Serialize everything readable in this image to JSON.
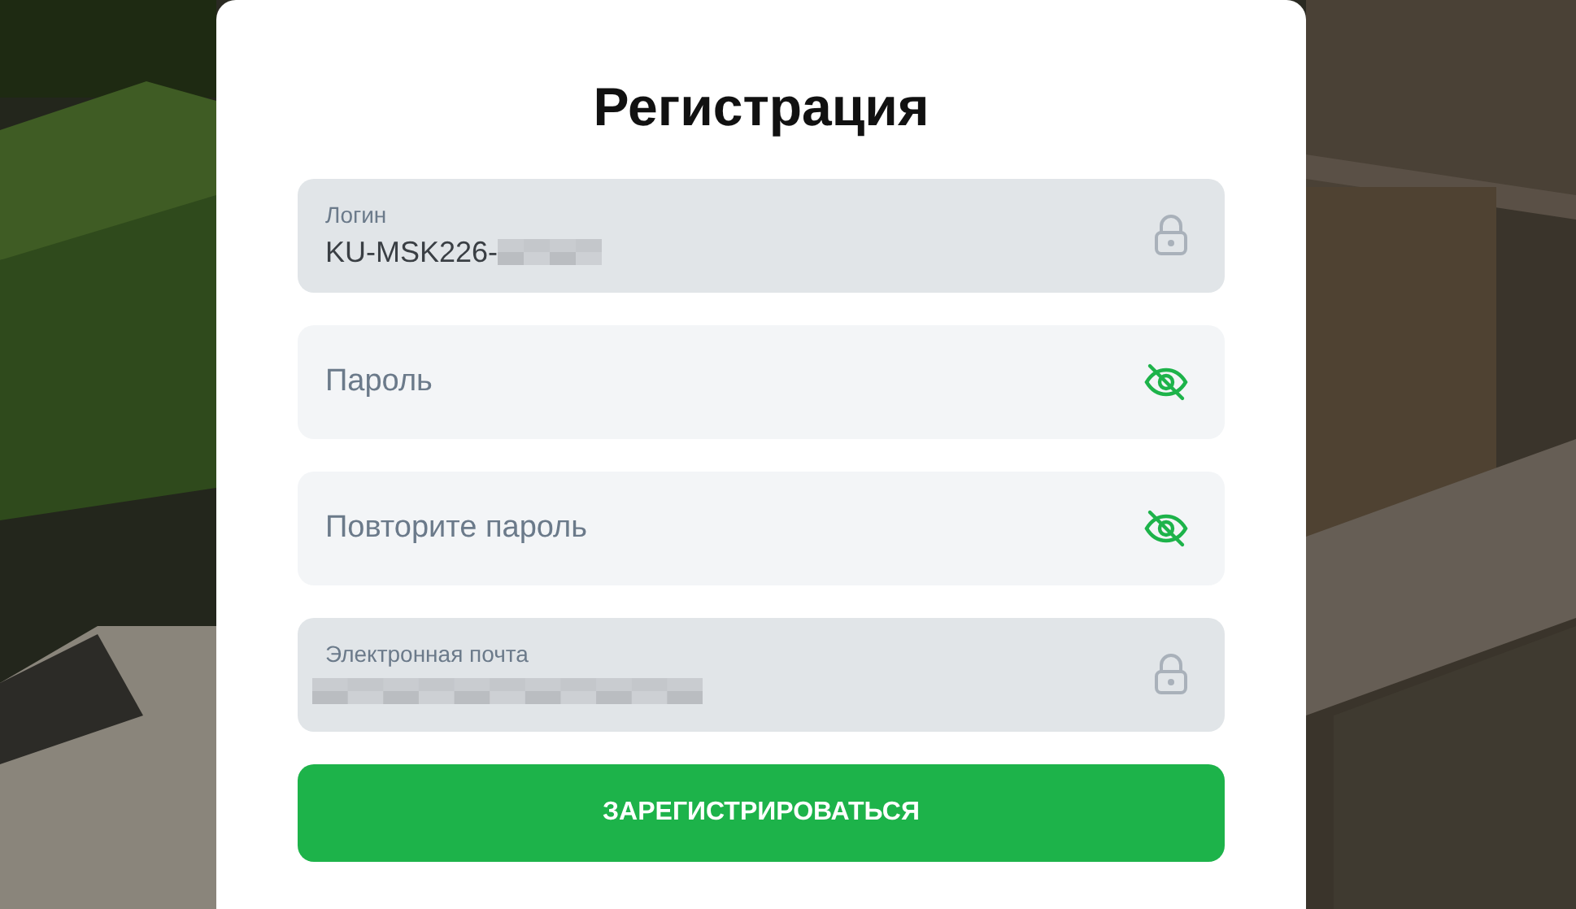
{
  "title": "Регистрация",
  "fields": [
    {
      "kind": "locked",
      "label": "Логин",
      "value": "KU-MSK226-",
      "redacted": true
    },
    {
      "kind": "password",
      "placeholder": "Пароль",
      "masked": true
    },
    {
      "kind": "password",
      "placeholder": "Повторите пароль",
      "masked": true
    },
    {
      "kind": "locked",
      "label": "Электронная почта",
      "redacted": true
    }
  ],
  "submit_button": "ЗАРЕГИСТРИРОВАТЬСЯ"
}
